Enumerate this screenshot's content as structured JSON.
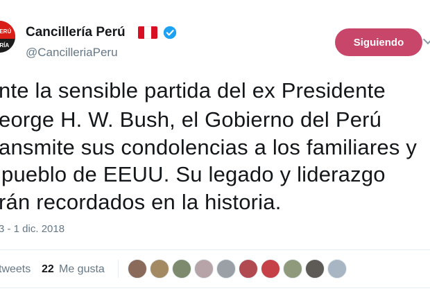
{
  "account": {
    "avatar_text_1": "PERÚ",
    "avatar_text_2": "ERÍA",
    "name": "Cancillería Perú",
    "handle": "@CancilleriaPeru",
    "follow_label": "Siguiendo"
  },
  "tweet": {
    "lines": [
      "nte la sensible partida del ex Presidente",
      "eorge H. W. Bush, el Gobierno del Perú",
      "ansmite sus condolencias a los familiares y",
      "pueblo de EEUU. Su legado y liderazgo",
      "rán recordados en la historia."
    ],
    "timestamp": "3 - 1 dic. 2018"
  },
  "stats": {
    "retweets_label": "tweets",
    "likes_count": "22",
    "likes_label": "Me gusta",
    "liker_colors": [
      "#8a6a5a",
      "#a38a62",
      "#7d8a6e",
      "#b7a4a8",
      "#9aa0a6",
      "#b04a50",
      "#c64048",
      "#8f9a7c",
      "#5e5a55",
      "#a7b6c2"
    ]
  },
  "colors": {
    "follow_button": "#c8466a",
    "verified": "#1da1f2",
    "secondary_text": "#657786"
  }
}
